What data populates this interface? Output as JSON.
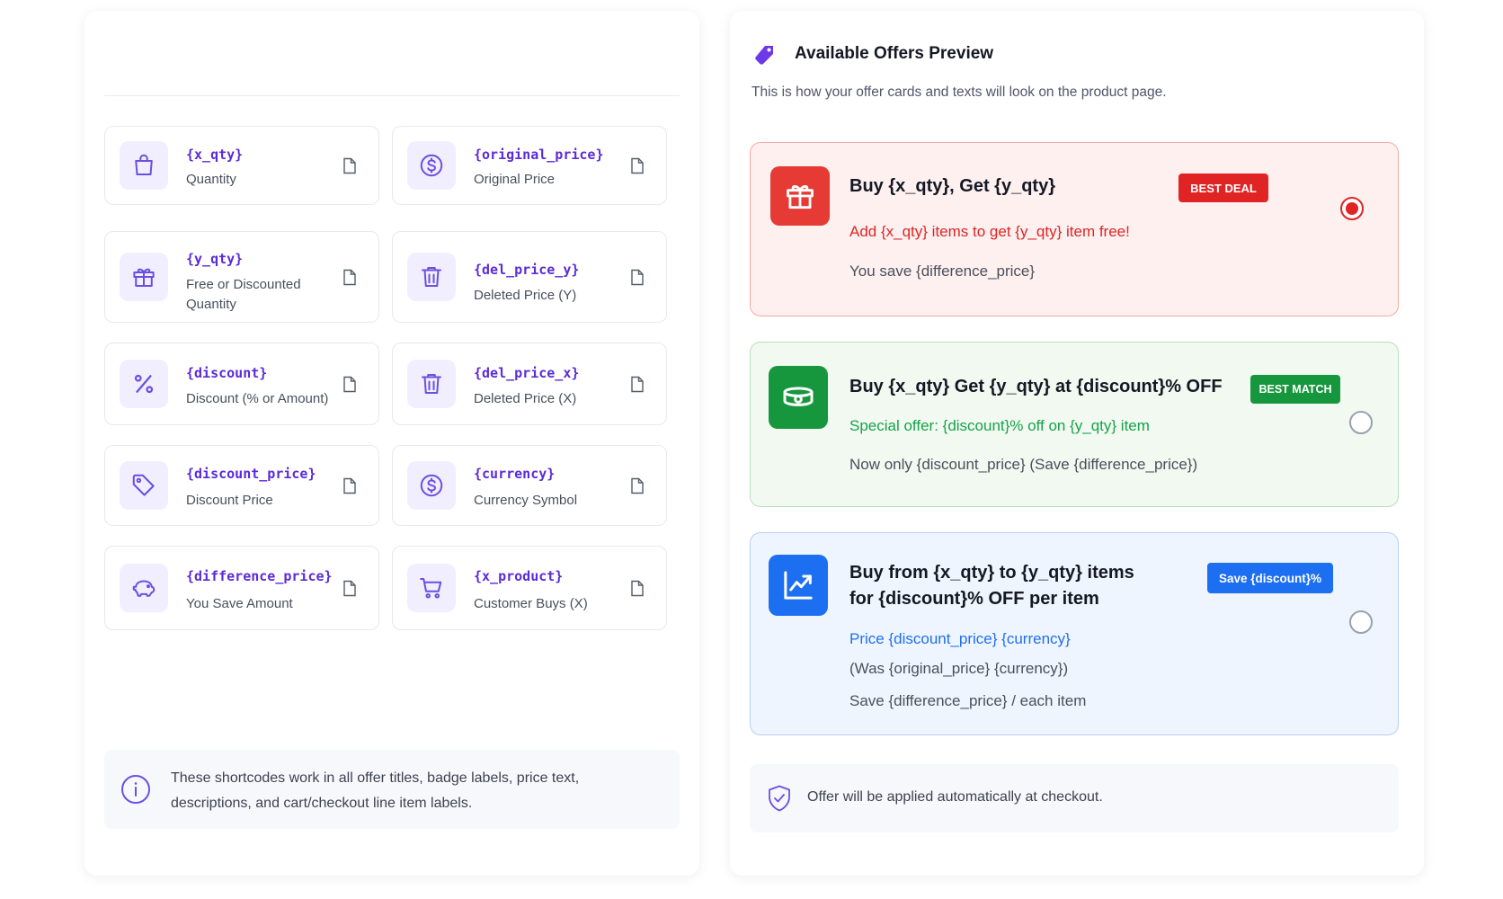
{
  "shortcodes": [
    {
      "code": "{x_qty}",
      "label": "Quantity",
      "icon": "shopping-bag-icon"
    },
    {
      "code": "{original_price}",
      "label": "Original Price",
      "icon": "dollar-circle-icon"
    },
    {
      "code": "{y_qty}",
      "label": "Free or Discounted Quantity",
      "icon": "gift-icon"
    },
    {
      "code": "{del_price_y}",
      "label": "Deleted Price (Y)",
      "icon": "trash-icon"
    },
    {
      "code": "{discount}",
      "label": "Discount (% or Amount)",
      "icon": "percent-icon"
    },
    {
      "code": "{del_price_x}",
      "label": "Deleted Price (X)",
      "icon": "trash-icon"
    },
    {
      "code": "{discount_price}",
      "label": "Discount Price",
      "icon": "price-tag-icon"
    },
    {
      "code": "{currency}",
      "label": "Currency Symbol",
      "icon": "dollar-circle-icon"
    },
    {
      "code": "{difference_price}",
      "label": "You Save Amount",
      "icon": "piggy-bank-icon"
    },
    {
      "code": "{x_product}",
      "label": "Customer Buys (X)",
      "icon": "cart-icon"
    }
  ],
  "info_note": "These shortcodes work in all offer titles, badge labels, price text, descriptions, and cart/checkout line item labels.",
  "preview": {
    "title": "Available Offers Preview",
    "subtitle": "This is how your offer cards and texts will look on the product page.",
    "offers": [
      {
        "title": "Buy {x_qty}, Get {y_qty}",
        "badge": "BEST DEAL",
        "line1": "Add {x_qty} items to get {y_qty} item free!",
        "line2": "You save {difference_price}",
        "selected": true,
        "accent": "#e02424",
        "icon": "gift-icon"
      },
      {
        "title": "Buy {x_qty} Get {y_qty} at {discount}% OFF",
        "badge": "BEST MATCH",
        "line1": "Special offer: {discount}% off on {y_qty} item",
        "line2": "Now only {discount_price} (Save {difference_price})",
        "selected": false,
        "accent": "#16a34a",
        "icon": "cash-icon"
      },
      {
        "title": "Buy from {x_qty} to {y_qty} items for {discount}% OFF per item",
        "badge": "Save {discount}%",
        "line1": "Price {discount_price} {currency}",
        "line2": "(Was {original_price} {currency})",
        "line3": "Save {difference_price} / each item",
        "selected": false,
        "accent": "#1d6ff2",
        "icon": "trend-chart-icon"
      }
    ],
    "checkout_note": "Offer will be applied automatically at checkout."
  }
}
